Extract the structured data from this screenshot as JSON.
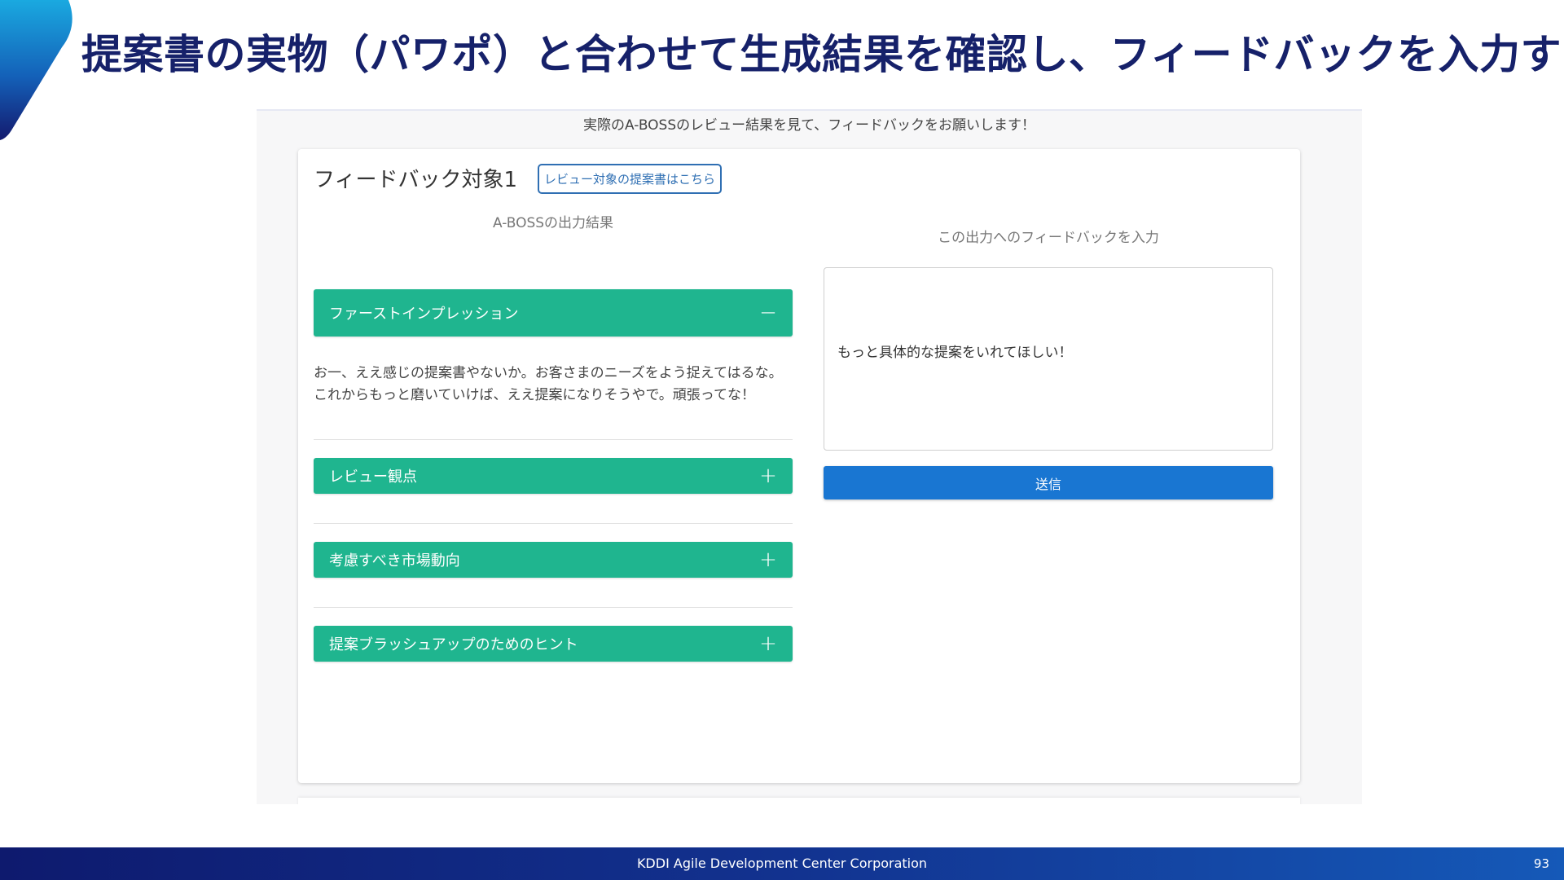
{
  "slide": {
    "title": "提案書の実物（パワポ）と合わせて生成結果を確認し、フィードバックを入力する",
    "footer_company": "KDDI Agile Development Center Corporation",
    "page_number": "93"
  },
  "app": {
    "instruction": "実際のA-BOSSのレビュー結果を見て、フィードバックをお願いします！",
    "card": {
      "title": "フィードバック対象1",
      "link_label": "レビュー対象の提案書はこちら",
      "left_heading": "A-BOSSの出力結果",
      "right_heading": "この出力へのフィードバックを入力",
      "accordions": [
        {
          "label": "ファーストインプレッション",
          "toggle": "−",
          "expanded": true,
          "body": "お一、ええ感じの提案書やないか。お客さまのニーズをよう捉えてはるな。これからもっと磨いていけば、ええ提案になりそうやで。頑張ってな！"
        },
        {
          "label": "レビュー観点",
          "toggle": "+",
          "expanded": false
        },
        {
          "label": "考慮すべき市場動向",
          "toggle": "+",
          "expanded": false
        },
        {
          "label": "提案ブラッシュアップのためのヒント",
          "toggle": "+",
          "expanded": false
        }
      ],
      "feedback_value": "もっと具体的な提案をいれてほしい！",
      "send_label": "送信"
    }
  },
  "colors": {
    "title": "#16216a",
    "accordion": "#1fb58f",
    "button": "#1976d2",
    "link": "#2f6fb3",
    "footer": "#12328f"
  }
}
